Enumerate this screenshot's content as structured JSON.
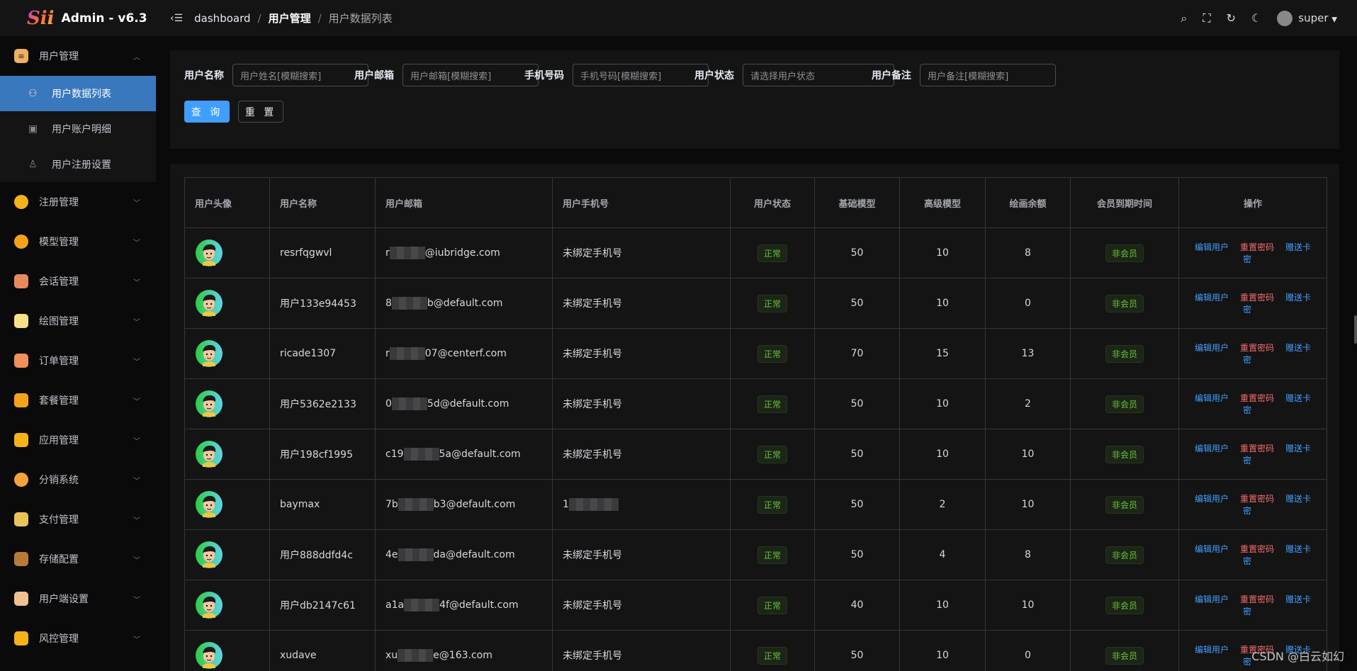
{
  "app": {
    "logo_text": "Sii",
    "title": "Admin - v6.3"
  },
  "breadcrumb": [
    "dashboard",
    "用户管理",
    "用户数据列表"
  ],
  "user": {
    "name": "super"
  },
  "sidebar": {
    "group": {
      "label": "用户管理",
      "icon": "user-manage-icon",
      "color": "#f0b060"
    },
    "subs": [
      {
        "label": "用户数据列表",
        "icon": "user-list-icon",
        "active": true
      },
      {
        "label": "用户账户明细",
        "icon": "wallet-icon"
      },
      {
        "label": "用户注册设置",
        "icon": "user-add-icon"
      }
    ],
    "items": [
      {
        "label": "注册管理",
        "icon": "register-icon",
        "color": "#f5b21b"
      },
      {
        "label": "模型管理",
        "icon": "model-cube-icon",
        "color": "#f5a21b"
      },
      {
        "label": "会话管理",
        "icon": "chat-icon",
        "color": "#e98a5c"
      },
      {
        "label": "绘图管理",
        "icon": "palette-icon",
        "color": "#f7e08a"
      },
      {
        "label": "订单管理",
        "icon": "order-icon",
        "color": "#f0905a"
      },
      {
        "label": "套餐管理",
        "icon": "package-cards-icon",
        "color": "#f5a21b"
      },
      {
        "label": "应用管理",
        "icon": "apps-icon",
        "color": "#f5b21b"
      },
      {
        "label": "分销系统",
        "icon": "paper-plane-icon",
        "color": "#f5a23b"
      },
      {
        "label": "支付管理",
        "icon": "payment-icon",
        "color": "#e8c35a"
      },
      {
        "label": "存储配置",
        "icon": "storage-icon",
        "color": "#b87a3a"
      },
      {
        "label": "用户端设置",
        "icon": "client-settings-icon",
        "color": "#f0c090"
      },
      {
        "label": "风控管理",
        "icon": "shield-icon",
        "color": "#f5b21b"
      }
    ]
  },
  "search": {
    "fields": [
      {
        "label": "用户名称",
        "placeholder": "用户姓名[模糊搜索]"
      },
      {
        "label": "用户邮箱",
        "placeholder": "用户邮箱[模糊搜索]"
      },
      {
        "label": "手机号码",
        "placeholder": "手机号码[模糊搜索]"
      },
      {
        "label": "用户状态",
        "placeholder": "请选择用户状态",
        "select": true
      },
      {
        "label": "用户备注",
        "placeholder": "用户备注[模糊搜索]"
      }
    ],
    "query_label": "查 询",
    "reset_label": "重 置"
  },
  "table": {
    "headers": [
      "用户头像",
      "用户名称",
      "用户邮箱",
      "用户手机号",
      "用户状态",
      "基础模型",
      "高级模型",
      "绘画余额",
      "会员到期时间",
      "操作"
    ],
    "actions": [
      "编辑用户",
      "重置密码",
      "赠送卡密"
    ],
    "rows": [
      {
        "name": "resrfqgwvl",
        "email_pre": "r",
        "email_post": "@iubridge.com",
        "phone": "未绑定手机号",
        "status": "正常",
        "basic": 50,
        "advanced": 10,
        "draw": 8,
        "member": "非会员"
      },
      {
        "name": "用户133e94453",
        "email_pre": "8",
        "email_post": "b@default.com",
        "phone": "未绑定手机号",
        "status": "正常",
        "basic": 50,
        "advanced": 10,
        "draw": 0,
        "member": "非会员"
      },
      {
        "name": "ricade1307",
        "email_pre": "r",
        "email_post": "07@centerf.com",
        "phone": "未绑定手机号",
        "status": "正常",
        "basic": 70,
        "advanced": 15,
        "draw": 13,
        "member": "非会员"
      },
      {
        "name": "用户5362e2133",
        "email_pre": "0",
        "email_post": "5d@default.com",
        "phone": "未绑定手机号",
        "status": "正常",
        "basic": 50,
        "advanced": 10,
        "draw": 2,
        "member": "非会员"
      },
      {
        "name": "用户198cf1995",
        "email_pre": "c19",
        "email_post": "5a@default.com",
        "phone": "未绑定手机号",
        "status": "正常",
        "basic": 50,
        "advanced": 10,
        "draw": 10,
        "member": "非会员"
      },
      {
        "name": "baymax",
        "email_pre": "7b",
        "email_post": "b3@default.com",
        "phone": "1",
        "phone_masked": true,
        "status": "正常",
        "basic": 50,
        "advanced": 2,
        "draw": 10,
        "member": "非会员"
      },
      {
        "name": "用户888ddfd4c",
        "email_pre": "4e",
        "email_post": "da@default.com",
        "phone": "未绑定手机号",
        "status": "正常",
        "basic": 50,
        "advanced": 4,
        "draw": 8,
        "member": "非会员"
      },
      {
        "name": "用户db2147c61",
        "email_pre": "a1a",
        "email_post": "4f@default.com",
        "phone": "未绑定手机号",
        "status": "正常",
        "basic": 40,
        "advanced": 10,
        "draw": 10,
        "member": "非会员"
      },
      {
        "name": "xudave",
        "email_pre": "xu",
        "email_post": "e@163.com",
        "phone": "未绑定手机号",
        "status": "正常",
        "basic": 50,
        "advanced": 10,
        "draw": 0,
        "member": "非会员"
      }
    ]
  },
  "watermark": "CSDN @白云如幻"
}
